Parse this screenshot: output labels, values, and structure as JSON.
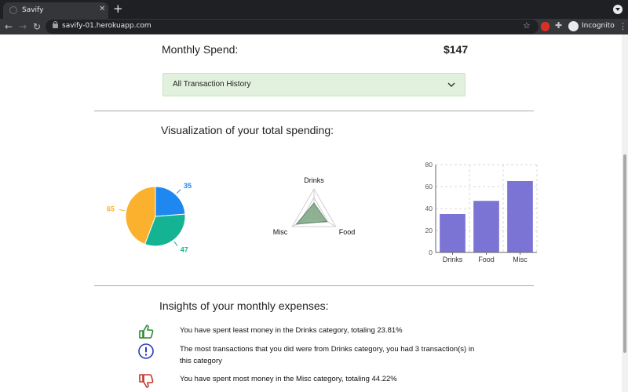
{
  "browser": {
    "tab_title": "Savify",
    "url": "savify-01.herokuapp.com",
    "incognito_label": "Incognito"
  },
  "summary": {
    "label": "Monthly Spend:",
    "value": "$147"
  },
  "history": {
    "label": "All Transaction History"
  },
  "visualization": {
    "heading": "Visualization of your total spending:"
  },
  "chart_data": [
    {
      "type": "pie",
      "slices": [
        {
          "label": "Drinks",
          "value": 35,
          "color": "#1e87f0"
        },
        {
          "label": "Food",
          "value": 47,
          "color": "#13b393"
        },
        {
          "label": "Misc",
          "value": 65,
          "color": "#fbb12d"
        }
      ],
      "data_labels": [
        "35",
        "47",
        "65"
      ]
    },
    {
      "type": "radar",
      "categories": [
        "Drinks",
        "Food",
        "Misc"
      ],
      "values": [
        35,
        47,
        65
      ],
      "fill": "#7fa583"
    },
    {
      "type": "bar",
      "categories": [
        "Drinks",
        "Food",
        "Misc"
      ],
      "values": [
        35,
        47,
        65
      ],
      "ylim": [
        0,
        80
      ],
      "yticks": [
        0,
        20,
        40,
        60,
        80
      ],
      "grid": true,
      "color": "#7b74d4"
    }
  ],
  "insights": {
    "heading": "Insights of your monthly expenses:",
    "items": [
      {
        "icon": "thumbs-up-icon",
        "color": "#2f8a2f",
        "text": "You have spent least money in the Drinks category, totaling 23.81%"
      },
      {
        "icon": "exclamation-circle-icon",
        "color": "#2a3cb8",
        "text": "The most transactions that you did were from Drinks category, you had 3 transaction(s) in this category"
      },
      {
        "icon": "thumbs-down-icon",
        "color": "#c0392b",
        "text": "You have spent most money in the Misc category, totaling 44.22%"
      }
    ]
  }
}
